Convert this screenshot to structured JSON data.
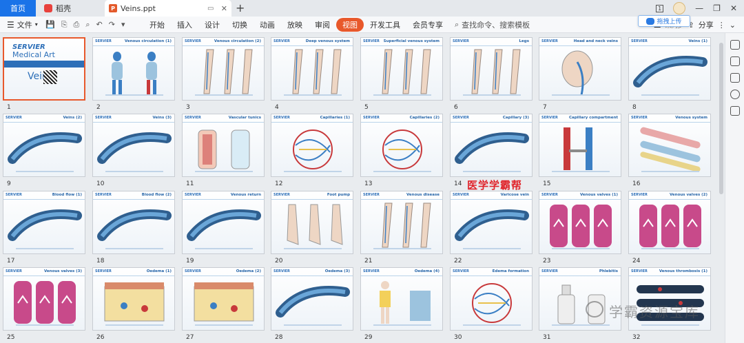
{
  "titlebar": {
    "home_tab": "首页",
    "docer_tab": "稻壳",
    "file_tab": "Veins.ppt",
    "tab_close": "✕",
    "new_tab": "+",
    "minimize": "—",
    "maximize": "❐",
    "close": "✕",
    "badge": "1"
  },
  "toolbar": {
    "file_label": "文件",
    "menu_items": [
      "开始",
      "插入",
      "设计",
      "切换",
      "动画",
      "放映",
      "审阅",
      "视图",
      "开发工具",
      "会员专享"
    ],
    "active_menu": "视图",
    "search_placeholder": "查找命令、搜索模板",
    "share_label": "分享",
    "upload_popup": "拖拽上传",
    "sync_label": "未同步"
  },
  "slides": [
    {
      "num": "1",
      "title": "",
      "cover_brand": "SERVIER",
      "cover_sub": "Medical Art",
      "cover_title": "Veins"
    },
    {
      "num": "2",
      "title": "Venous circulation (1)"
    },
    {
      "num": "3",
      "title": "Venous circulation (2)"
    },
    {
      "num": "4",
      "title": "Deep venous system"
    },
    {
      "num": "5",
      "title": "Superficial venous system"
    },
    {
      "num": "6",
      "title": "Legs"
    },
    {
      "num": "7",
      "title": "Head and neck veins"
    },
    {
      "num": "8",
      "title": "Veins (1)"
    },
    {
      "num": "9",
      "title": "Veins (2)"
    },
    {
      "num": "10",
      "title": "Veins (3)"
    },
    {
      "num": "11",
      "title": "Vascular tunics"
    },
    {
      "num": "12",
      "title": "Capillaries (1)"
    },
    {
      "num": "13",
      "title": "Capillaries (2)"
    },
    {
      "num": "14",
      "title": "Capillary (3)"
    },
    {
      "num": "15",
      "title": "Capillary compartment"
    },
    {
      "num": "16",
      "title": "Venous system"
    },
    {
      "num": "17",
      "title": "Blood flow (1)"
    },
    {
      "num": "18",
      "title": "Blood flow (2)"
    },
    {
      "num": "19",
      "title": "Venous return"
    },
    {
      "num": "20",
      "title": "Foot pump"
    },
    {
      "num": "21",
      "title": "Venous disease"
    },
    {
      "num": "22",
      "title": "Varicose vein"
    },
    {
      "num": "23",
      "title": "Venous valves (1)"
    },
    {
      "num": "24",
      "title": "Venous valves (2)"
    },
    {
      "num": "25",
      "title": "Venous valves (3)"
    },
    {
      "num": "26",
      "title": "Oedema (1)"
    },
    {
      "num": "27",
      "title": "Oedema (2)"
    },
    {
      "num": "28",
      "title": "Oedema (3)"
    },
    {
      "num": "29",
      "title": "Oedema (4)"
    },
    {
      "num": "30",
      "title": "Edema formation"
    },
    {
      "num": "31",
      "title": "Phlebitis"
    },
    {
      "num": "32",
      "title": "Venous thrombosis (1)"
    }
  ],
  "brand_small": "SERVIER",
  "watermarks": {
    "red": "医学学霸帮",
    "gray": "学霸资源宝库"
  },
  "colors": {
    "accent": "#e8582b",
    "brand_blue": "#2d6fb8",
    "home_tab": "#1a73e8"
  },
  "art_types": [
    "cover",
    "body",
    "legs",
    "legs",
    "legs",
    "legs",
    "head",
    "vein",
    "vein",
    "vein",
    "tunic",
    "capillary",
    "capillary",
    "vein",
    "vessels",
    "tubes",
    "vein",
    "vein",
    "vein",
    "feet",
    "legs",
    "vein",
    "valve",
    "valve",
    "valve",
    "oedema",
    "oedema",
    "vein",
    "figure",
    "capillary",
    "bottle",
    "thrombus"
  ]
}
